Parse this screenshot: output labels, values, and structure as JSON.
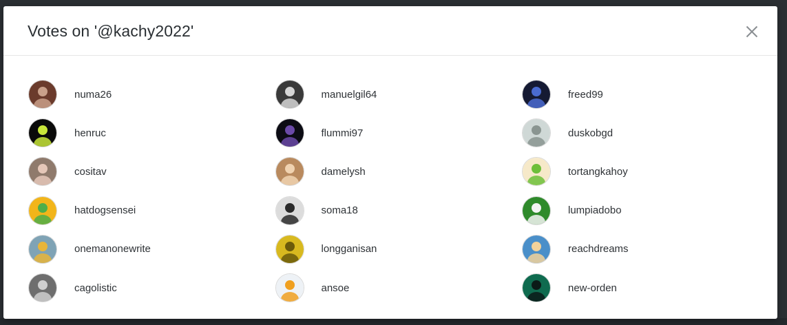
{
  "modal": {
    "title": "Votes on '@kachy2022'"
  },
  "voters": [
    {
      "name": "numa26",
      "avatar": {
        "icon": "woman-with-flowers-avatar",
        "bg": "#6b3b2c",
        "fg": "#c9a08a"
      }
    },
    {
      "name": "manuelgil64",
      "avatar": {
        "icon": "man-portrait-bw-avatar",
        "bg": "#3a3a3a",
        "fg": "#d6d6d6"
      }
    },
    {
      "name": "freed99",
      "avatar": {
        "icon": "dark-fantasy-figure-avatar",
        "bg": "#151a33",
        "fg": "#4a6bd1"
      }
    },
    {
      "name": "henruc",
      "avatar": {
        "icon": "black-logo-avatar",
        "bg": "#0a0a0a",
        "fg": "#c8e63a"
      }
    },
    {
      "name": "flummi97",
      "avatar": {
        "icon": "purple-ghost-creature-avatar",
        "bg": "#0c0c14",
        "fg": "#6b4aa8"
      }
    },
    {
      "name": "duskobgd",
      "avatar": {
        "icon": "sketch-face-avatar",
        "bg": "#cfd8d6",
        "fg": "#8a9591"
      }
    },
    {
      "name": "cositav",
      "avatar": {
        "icon": "two-women-selfie-avatar",
        "bg": "#8f7a6c",
        "fg": "#e5c7b8"
      }
    },
    {
      "name": "damelysh",
      "avatar": {
        "icon": "smiling-woman-avatar",
        "bg": "#b98a5e",
        "fg": "#f0d2b0"
      }
    },
    {
      "name": "tortangkahoy",
      "avatar": {
        "icon": "anime-green-eyes-avatar",
        "bg": "#f6e9c9",
        "fg": "#6dbf3a"
      }
    },
    {
      "name": "hatdogsensei",
      "avatar": {
        "icon": "green-cartoon-figure-avatar",
        "bg": "#f2b51a",
        "fg": "#4fae49"
      }
    },
    {
      "name": "soma18",
      "avatar": {
        "icon": "woman-bw-portrait-avatar",
        "bg": "#dcdcdc",
        "fg": "#2a2a2a"
      }
    },
    {
      "name": "lumpiadobo",
      "avatar": {
        "icon": "cartoon-chef-avatar",
        "bg": "#2f8a2b",
        "fg": "#f3f3f3"
      }
    },
    {
      "name": "onemanonewrite",
      "avatar": {
        "icon": "pixel-character-avatar",
        "bg": "#7fa3b5",
        "fg": "#e8b53a"
      }
    },
    {
      "name": "longganisan",
      "avatar": {
        "icon": "golden-leaf-avatar",
        "bg": "#d8b91f",
        "fg": "#6b5a0a"
      }
    },
    {
      "name": "reachdreams",
      "avatar": {
        "icon": "cartoon-boy-cap-avatar",
        "bg": "#4a8fc9",
        "fg": "#f2d29a"
      }
    },
    {
      "name": "cagolistic",
      "avatar": {
        "icon": "man-profile-avatar",
        "bg": "#6e6e6e",
        "fg": "#cfcfcf"
      }
    },
    {
      "name": "ansoe",
      "avatar": {
        "icon": "cartoon-bee-avatar",
        "bg": "#eef2f6",
        "fg": "#f0a020"
      }
    },
    {
      "name": "new-orden",
      "avatar": {
        "icon": "green-cat-avatar",
        "bg": "#0f6b4f",
        "fg": "#0b1a17"
      }
    }
  ],
  "icons": {
    "close": "close-icon"
  },
  "colors": {
    "title_text": "#2a2f33",
    "name_text": "#2e3236",
    "close_icon": "#8a8e92",
    "backdrop": "#2b2f33"
  }
}
